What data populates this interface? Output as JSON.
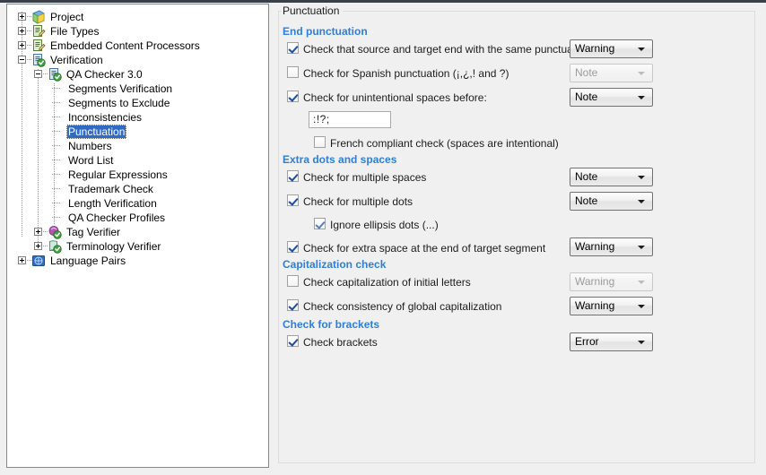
{
  "window": {
    "tree_panel_name": "options-navigation-tree",
    "group_title": "Punctuation"
  },
  "tree": {
    "items": [
      {
        "label": "Project",
        "indent": 0,
        "expander": "plus",
        "icon": "project-icon",
        "selected": false
      },
      {
        "label": "File Types",
        "indent": 0,
        "expander": "plus",
        "icon": "file-types-icon",
        "selected": false
      },
      {
        "label": "Embedded Content Processors",
        "indent": 0,
        "expander": "plus",
        "icon": "embedded-content-icon",
        "selected": false
      },
      {
        "label": "Verification",
        "indent": 0,
        "expander": "minus",
        "icon": "verification-icon",
        "selected": false
      },
      {
        "label": "QA Checker 3.0",
        "indent": 1,
        "expander": "minus",
        "icon": "qa-checker-icon",
        "selected": false
      },
      {
        "label": "Segments Verification",
        "indent": 2,
        "expander": "none",
        "icon": "none",
        "selected": false
      },
      {
        "label": "Segments to Exclude",
        "indent": 2,
        "expander": "none",
        "icon": "none",
        "selected": false
      },
      {
        "label": "Inconsistencies",
        "indent": 2,
        "expander": "none",
        "icon": "none",
        "selected": false
      },
      {
        "label": "Punctuation",
        "indent": 2,
        "expander": "none",
        "icon": "none",
        "selected": true
      },
      {
        "label": "Numbers",
        "indent": 2,
        "expander": "none",
        "icon": "none",
        "selected": false
      },
      {
        "label": "Word List",
        "indent": 2,
        "expander": "none",
        "icon": "none",
        "selected": false
      },
      {
        "label": "Regular Expressions",
        "indent": 2,
        "expander": "none",
        "icon": "none",
        "selected": false
      },
      {
        "label": "Trademark Check",
        "indent": 2,
        "expander": "none",
        "icon": "none",
        "selected": false
      },
      {
        "label": "Length Verification",
        "indent": 2,
        "expander": "none",
        "icon": "none",
        "selected": false
      },
      {
        "label": "QA Checker Profiles",
        "indent": 2,
        "expander": "none",
        "icon": "none",
        "selected": false
      },
      {
        "label": "Tag Verifier",
        "indent": 1,
        "expander": "plus",
        "icon": "tag-verifier-icon",
        "selected": false
      },
      {
        "label": "Terminology Verifier",
        "indent": 1,
        "expander": "plus",
        "icon": "terminology-verifier-icon",
        "selected": false
      },
      {
        "label": "Language Pairs",
        "indent": 0,
        "expander": "plus",
        "icon": "language-pairs-icon",
        "selected": false
      }
    ]
  },
  "sections": {
    "end_punctuation": "End punctuation",
    "extra_dots_spaces": "Extra dots and spaces",
    "capitalization": "Capitalization check",
    "brackets": "Check for brackets"
  },
  "options": {
    "same_punctuation": {
      "label": "Check that source and target end with the same punctuation",
      "checked": true,
      "enabled": true
    },
    "spanish_punctuation": {
      "label": "Check for Spanish punctuation (¡,¿,! and ?)",
      "checked": false,
      "enabled": true
    },
    "unintentional_spaces": {
      "label": "Check for unintentional spaces before:",
      "checked": true,
      "enabled": true
    },
    "spaces_chars": {
      "value": ":!?;"
    },
    "french_compliant": {
      "label": "French compliant check (spaces are intentional)",
      "checked": false,
      "enabled": true
    },
    "multiple_spaces": {
      "label": "Check for multiple spaces",
      "checked": true,
      "enabled": true
    },
    "multiple_dots": {
      "label": "Check for multiple dots",
      "checked": true,
      "enabled": true
    },
    "ignore_ellipsis": {
      "label": "Ignore ellipsis dots (...)",
      "checked": true,
      "enabled": true
    },
    "extra_space_end": {
      "label": "Check for extra space at the end of target segment",
      "checked": true,
      "enabled": true
    },
    "initial_letters": {
      "label": "Check capitalization of initial letters",
      "checked": false,
      "enabled": true
    },
    "global_capitalization": {
      "label": "Check consistency of global capitalization",
      "checked": true,
      "enabled": true
    },
    "check_brackets": {
      "label": "Check brackets",
      "checked": true,
      "enabled": true
    }
  },
  "severity": {
    "same_punctuation": {
      "value": "Warning",
      "enabled": true
    },
    "spanish_punctuation": {
      "value": "Note",
      "enabled": false
    },
    "unintentional_spaces": {
      "value": "Note",
      "enabled": true
    },
    "multiple_spaces": {
      "value": "Note",
      "enabled": true
    },
    "multiple_dots": {
      "value": "Note",
      "enabled": true
    },
    "extra_space_end": {
      "value": "Warning",
      "enabled": true
    },
    "initial_letters": {
      "value": "Warning",
      "enabled": false
    },
    "global_capitalization": {
      "value": "Warning",
      "enabled": true
    },
    "check_brackets": {
      "value": "Error",
      "enabled": true
    }
  },
  "colors": {
    "section_heading": "#2f7ed8",
    "selection": "#316ac5",
    "panel_bg": "#f0f0f0"
  }
}
